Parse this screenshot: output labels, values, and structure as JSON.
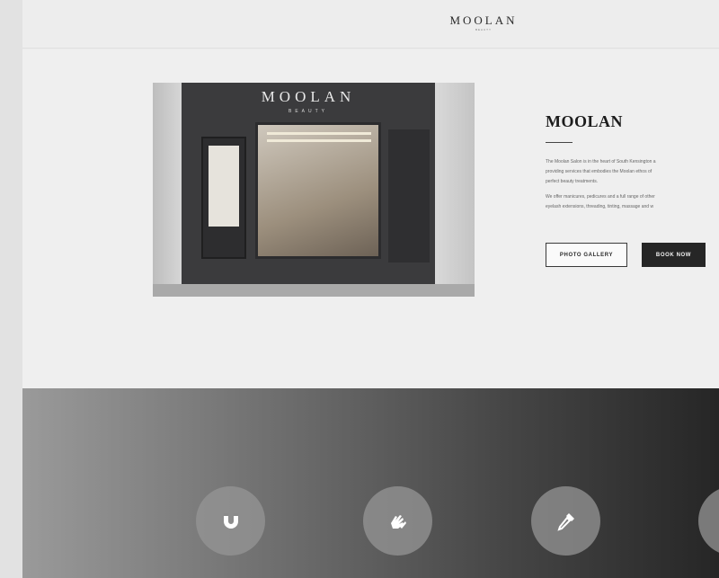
{
  "header": {
    "logo_main": "MOOLAN",
    "logo_sub": "BEAUTY"
  },
  "hero": {
    "image": {
      "sign_main": "MOOLAN",
      "sign_sub": "BEAUTY"
    },
    "title": "MOOLAN",
    "paragraph_1_lines": [
      "The Moolan Salon is in the heart of South Kensington a",
      "providing services that embodies the Moolan ethos of",
      "perfect beauty treatments."
    ],
    "paragraph_2_lines": [
      "We offer manicures, pedicures and a full range of other",
      "eyelash extensions, threading, tinting, massage and w"
    ],
    "buttons": {
      "photo_gallery": "PHOTO GALLERY",
      "book_now": "BOOK NOW"
    }
  },
  "services": {
    "icons": [
      "magnet-icon",
      "hands-icon",
      "dropper-icon",
      "service-icon"
    ]
  },
  "colors": {
    "accent_dark": "#262626",
    "page_bg": "#ececec"
  }
}
